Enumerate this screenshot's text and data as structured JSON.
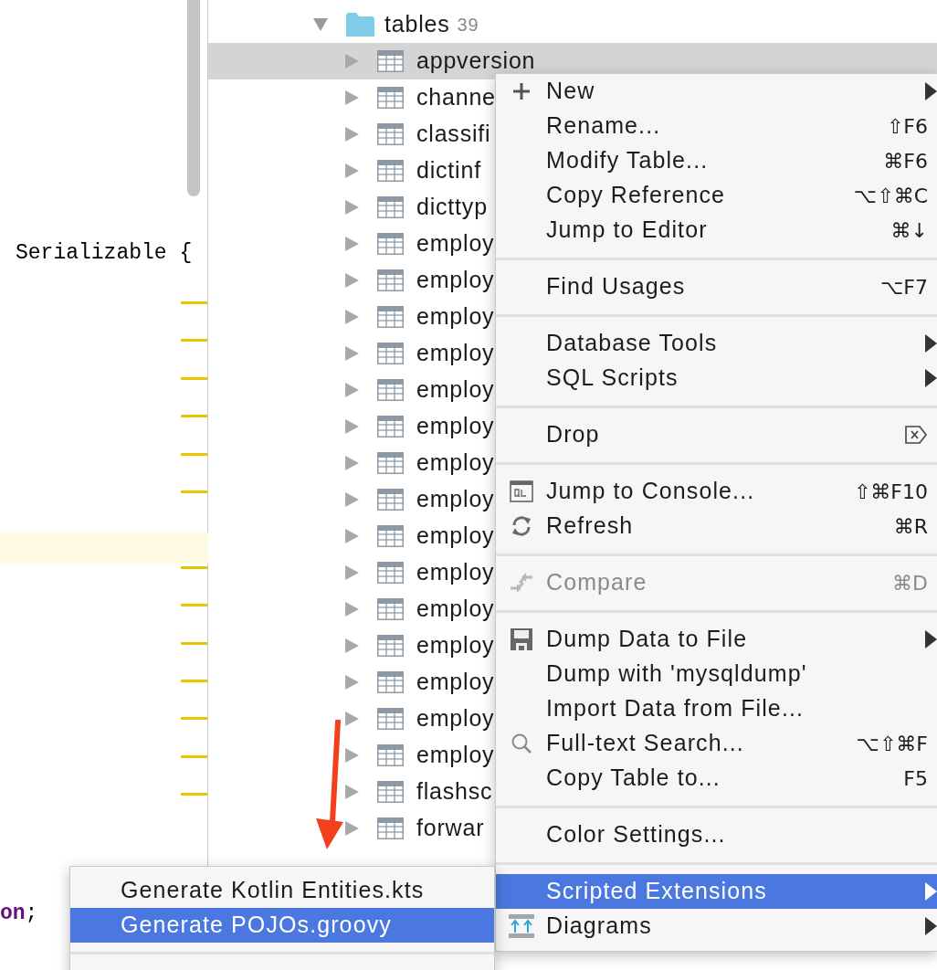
{
  "editor": {
    "lines": [
      {
        "tokens": [
          {
            "kind": "plain",
            "text": "Serializable {"
          }
        ]
      },
      {
        "tokens": [
          {
            "kind": "field",
            "text": "on"
          },
          {
            "kind": "plain",
            "text": ";"
          }
        ]
      }
    ]
  },
  "tree": {
    "label": "tables",
    "count": "39",
    "expanded": true,
    "children": [
      {
        "label": "appversion",
        "selected": true
      },
      {
        "label": "channe",
        "selected": false
      },
      {
        "label": "classifi",
        "selected": false
      },
      {
        "label": "dictinf",
        "selected": false
      },
      {
        "label": "dicttyp",
        "selected": false
      },
      {
        "label": "employ",
        "selected": false
      },
      {
        "label": "employ",
        "selected": false
      },
      {
        "label": "employ",
        "selected": false
      },
      {
        "label": "employ",
        "selected": false
      },
      {
        "label": "employ",
        "selected": false
      },
      {
        "label": "employ",
        "selected": false
      },
      {
        "label": "employ",
        "selected": false
      },
      {
        "label": "employ",
        "selected": false
      },
      {
        "label": "employ",
        "selected": false
      },
      {
        "label": "employ",
        "selected": false
      },
      {
        "label": "employ",
        "selected": false
      },
      {
        "label": "employ",
        "selected": false
      },
      {
        "label": "employ",
        "selected": false
      },
      {
        "label": "employ",
        "selected": false
      },
      {
        "label": "employ",
        "selected": false
      },
      {
        "label": "flashsc",
        "selected": false
      },
      {
        "label": "forwar",
        "selected": false
      }
    ]
  },
  "context_menu": {
    "items": [
      {
        "kind": "item",
        "label": "New",
        "submenu": true,
        "disabled": false,
        "selected": false
      },
      {
        "kind": "item",
        "label": "Rename...",
        "shortcut": "⇧F6",
        "submenu": false,
        "disabled": false,
        "selected": false
      },
      {
        "kind": "item",
        "label": "Modify Table...",
        "shortcut": "⌘F6",
        "submenu": false,
        "disabled": false,
        "selected": false
      },
      {
        "kind": "item",
        "label": "Copy Reference",
        "shortcut": "⌥⇧⌘C",
        "submenu": false,
        "disabled": false,
        "selected": false
      },
      {
        "kind": "item",
        "label": "Jump to Editor",
        "shortcut": "⌘↓",
        "submenu": false,
        "disabled": false,
        "selected": false
      },
      {
        "kind": "separator"
      },
      {
        "kind": "item",
        "label": "Find Usages",
        "shortcut": "⌥F7",
        "submenu": false,
        "disabled": false,
        "selected": false
      },
      {
        "kind": "separator"
      },
      {
        "kind": "item",
        "label": "Database Tools",
        "submenu": true,
        "disabled": false,
        "selected": false
      },
      {
        "kind": "item",
        "label": "SQL Scripts",
        "submenu": true,
        "disabled": false,
        "selected": false
      },
      {
        "kind": "separator"
      },
      {
        "kind": "item",
        "label": "Drop",
        "submenu": false,
        "disabled": false,
        "selected": false
      },
      {
        "kind": "separator"
      },
      {
        "kind": "item",
        "label": "Jump to Console...",
        "shortcut": "⇧⌘F10",
        "submenu": false,
        "disabled": false,
        "selected": false
      },
      {
        "kind": "item",
        "label": "Refresh",
        "shortcut": "⌘R",
        "submenu": false,
        "disabled": false,
        "selected": false
      },
      {
        "kind": "separator"
      },
      {
        "kind": "item",
        "label": "Compare",
        "shortcut": "⌘D",
        "submenu": false,
        "disabled": true,
        "selected": false
      },
      {
        "kind": "separator"
      },
      {
        "kind": "item",
        "label": "Dump Data to File",
        "submenu": true,
        "disabled": false,
        "selected": false
      },
      {
        "kind": "item",
        "label": "Dump with 'mysqldump'",
        "submenu": false,
        "disabled": false,
        "selected": false
      },
      {
        "kind": "item",
        "label": "Import Data from File...",
        "submenu": false,
        "disabled": false,
        "selected": false
      },
      {
        "kind": "item",
        "label": "Full-text Search...",
        "shortcut": "⌥⇧⌘F",
        "submenu": false,
        "disabled": false,
        "selected": false
      },
      {
        "kind": "item",
        "label": "Copy Table to...",
        "shortcut": "F5",
        "submenu": false,
        "disabled": false,
        "selected": false
      },
      {
        "kind": "separator"
      },
      {
        "kind": "item",
        "label": "Color Settings...",
        "submenu": false,
        "disabled": false,
        "selected": false
      },
      {
        "kind": "separator"
      },
      {
        "kind": "item",
        "label": "Scripted Extensions",
        "submenu": true,
        "disabled": false,
        "selected": true
      },
      {
        "kind": "item",
        "label": "Diagrams",
        "submenu": true,
        "disabled": false,
        "selected": false
      }
    ]
  },
  "submenu": {
    "items": [
      {
        "label": "Generate Kotlin Entities.kts",
        "selected": false
      },
      {
        "label": "Generate POJOs.groovy",
        "selected": true
      }
    ]
  }
}
